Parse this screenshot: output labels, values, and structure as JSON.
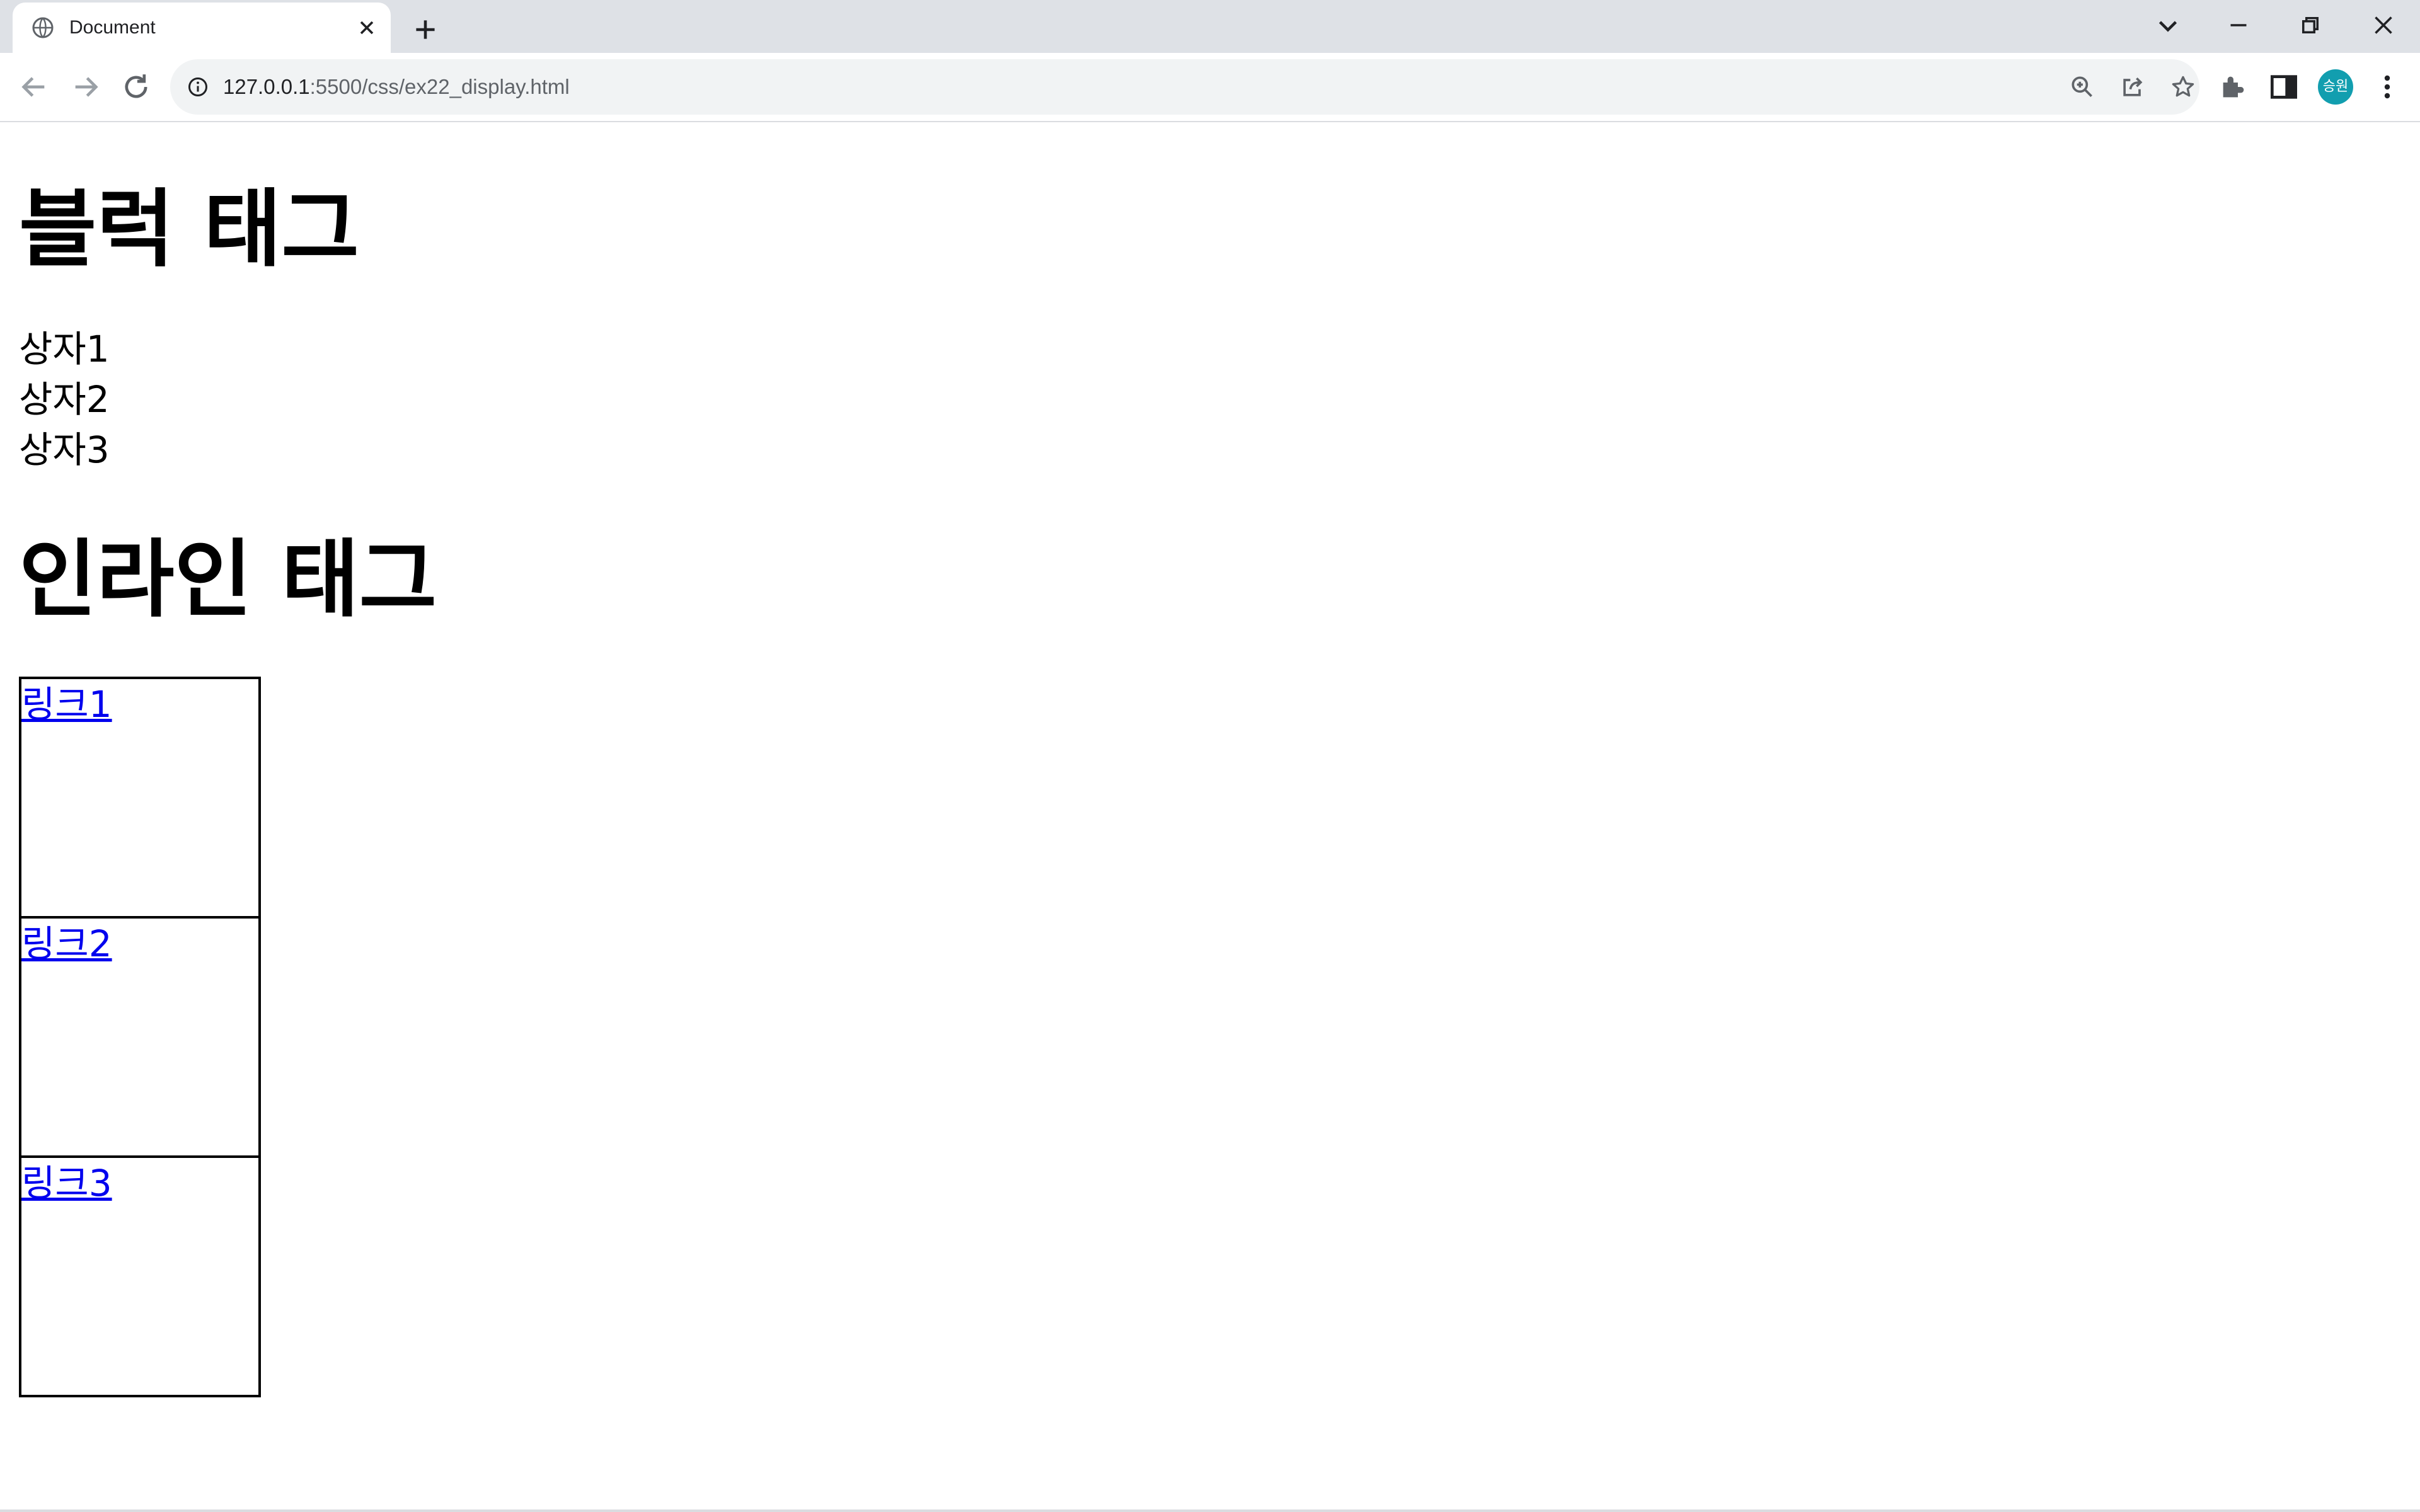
{
  "browser": {
    "tab": {
      "title": "Document",
      "favicon_icon": "globe-icon",
      "close_icon": "close-icon"
    },
    "new_tab_icon": "plus-icon",
    "window_controls": [
      "chevron-down-icon",
      "minimize-icon",
      "restore-icon",
      "close-icon"
    ],
    "nav": [
      "back-arrow-icon",
      "forward-arrow-icon",
      "reload-icon"
    ],
    "address": {
      "info_icon": "info-icon",
      "host": "127.0.0.1",
      "path": ":5500/css/ex22_display.html",
      "actions": [
        "zoom-icon",
        "share-icon",
        "star-icon"
      ]
    },
    "toolbar_icons": [
      "extensions-icon",
      "side-panel-icon",
      "menu-dots-icon"
    ],
    "profile_avatar": "승원"
  },
  "page": {
    "heading_block": "블럭 태그",
    "block_items": [
      "상자1",
      "상자2",
      "상자3"
    ],
    "heading_inline": "인라인 태그",
    "links": [
      "링크1",
      "링크2",
      "링크3"
    ]
  },
  "colors": {
    "tabstrip": "#dee1e6",
    "omnibox": "#f1f3f4",
    "link": "#0000ee",
    "avatar": "#129eaf"
  }
}
